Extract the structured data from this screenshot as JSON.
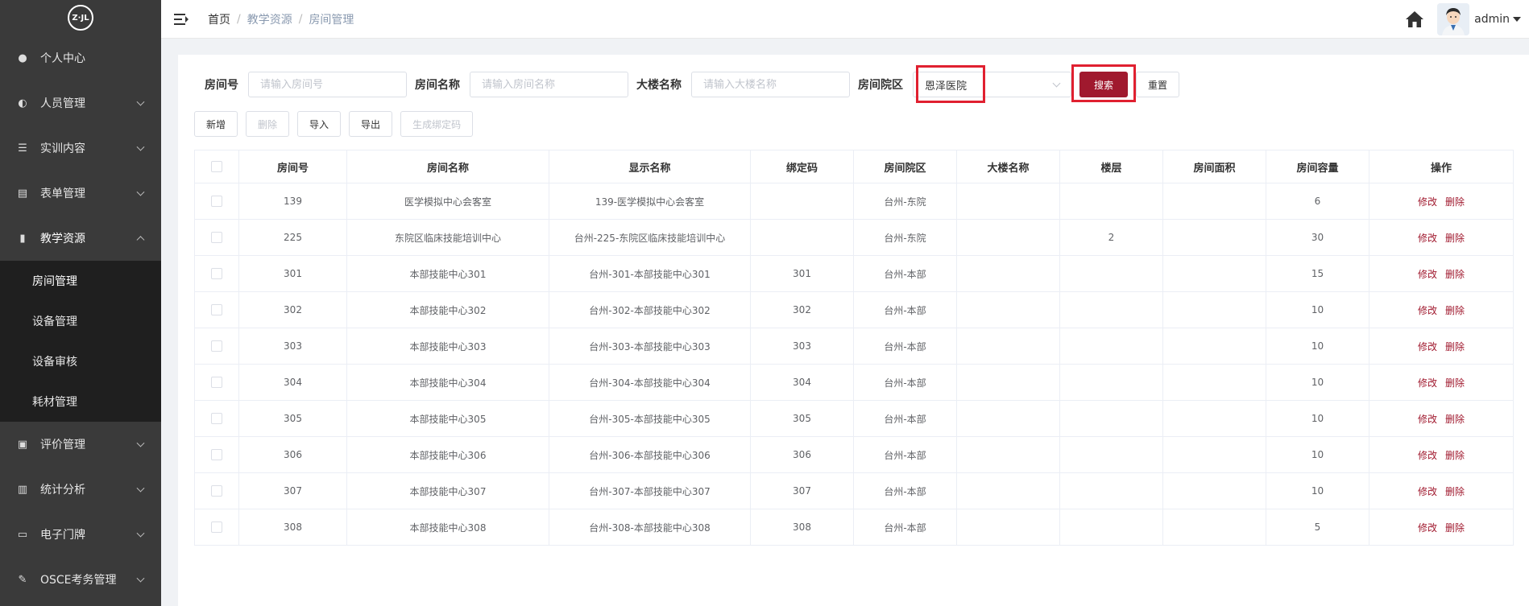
{
  "sidebar": {
    "logo_text": "Z·JL",
    "items": [
      {
        "label": "个人中心",
        "icon": "user-icon",
        "glyph": "●"
      },
      {
        "label": "人员管理",
        "icon": "users-icon",
        "glyph": "◐"
      },
      {
        "label": "实训内容",
        "icon": "list-icon",
        "glyph": "☰"
      },
      {
        "label": "表单管理",
        "icon": "form-icon",
        "glyph": "▤"
      },
      {
        "label": "教学资源",
        "icon": "book-icon",
        "glyph": "▮"
      }
    ],
    "submenu": [
      {
        "label": "房间管理"
      },
      {
        "label": "设备管理"
      },
      {
        "label": "设备审核"
      },
      {
        "label": "耗材管理"
      }
    ],
    "items_after": [
      {
        "label": "评价管理",
        "icon": "evaluation-icon",
        "glyph": "▣"
      },
      {
        "label": "统计分析",
        "icon": "bar-chart-icon",
        "glyph": "▥"
      },
      {
        "label": "电子门牌",
        "icon": "monitor-icon",
        "glyph": "▭"
      },
      {
        "label": "OSCE考务管理",
        "icon": "edit-icon",
        "glyph": "✎"
      }
    ]
  },
  "header": {
    "breadcrumb": [
      "首页",
      "教学资源",
      "房间管理"
    ],
    "username": "admin"
  },
  "search": {
    "room_no_label": "房间号",
    "room_no_placeholder": "请输入房间号",
    "room_name_label": "房间名称",
    "room_name_placeholder": "请输入房间名称",
    "building_label": "大楼名称",
    "building_placeholder": "请输入大楼名称",
    "campus_label": "房间院区",
    "campus_value": "恩泽医院",
    "search_button": "搜索",
    "reset_button": "重置"
  },
  "actions": {
    "add": "新增",
    "delete": "删除",
    "import": "导入",
    "export": "导出",
    "generate_code": "生成绑定码"
  },
  "table": {
    "columns": [
      "房间号",
      "房间名称",
      "显示名称",
      "绑定码",
      "房间院区",
      "大楼名称",
      "楼层",
      "房间面积",
      "房间容量",
      "操作"
    ],
    "rows": [
      {
        "no": "139",
        "name": "医学模拟中心会客室",
        "display": "139-医学模拟中心会客室",
        "code": "",
        "campus": "台州-东院",
        "building": "",
        "floor": "",
        "area": "",
        "capacity": "6"
      },
      {
        "no": "225",
        "name": "东院区临床技能培训中心",
        "display": "台州-225-东院区临床技能培训中心",
        "code": "",
        "campus": "台州-东院",
        "building": "",
        "floor": "2",
        "area": "",
        "capacity": "30"
      },
      {
        "no": "301",
        "name": "本部技能中心301",
        "display": "台州-301-本部技能中心301",
        "code": "301",
        "campus": "台州-本部",
        "building": "",
        "floor": "",
        "area": "",
        "capacity": "15"
      },
      {
        "no": "302",
        "name": "本部技能中心302",
        "display": "台州-302-本部技能中心302",
        "code": "302",
        "campus": "台州-本部",
        "building": "",
        "floor": "",
        "area": "",
        "capacity": "10"
      },
      {
        "no": "303",
        "name": "本部技能中心303",
        "display": "台州-303-本部技能中心303",
        "code": "303",
        "campus": "台州-本部",
        "building": "",
        "floor": "",
        "area": "",
        "capacity": "10"
      },
      {
        "no": "304",
        "name": "本部技能中心304",
        "display": "台州-304-本部技能中心304",
        "code": "304",
        "campus": "台州-本部",
        "building": "",
        "floor": "",
        "area": "",
        "capacity": "10"
      },
      {
        "no": "305",
        "name": "本部技能中心305",
        "display": "台州-305-本部技能中心305",
        "code": "305",
        "campus": "台州-本部",
        "building": "",
        "floor": "",
        "area": "",
        "capacity": "10"
      },
      {
        "no": "306",
        "name": "本部技能中心306",
        "display": "台州-306-本部技能中心306",
        "code": "306",
        "campus": "台州-本部",
        "building": "",
        "floor": "",
        "area": "",
        "capacity": "10"
      },
      {
        "no": "307",
        "name": "本部技能中心307",
        "display": "台州-307-本部技能中心307",
        "code": "307",
        "campus": "台州-本部",
        "building": "",
        "floor": "",
        "area": "",
        "capacity": "10"
      },
      {
        "no": "308",
        "name": "本部技能中心308",
        "display": "台州-308-本部技能中心308",
        "code": "308",
        "campus": "台州-本部",
        "building": "",
        "floor": "",
        "area": "",
        "capacity": "5"
      }
    ],
    "op_edit": "修改",
    "op_delete": "删除"
  },
  "colors": {
    "primary": "#a0192e",
    "sidebar_bg": "#3a3a3a",
    "submenu_bg": "#1f1f1f",
    "highlight": "#e02030"
  }
}
